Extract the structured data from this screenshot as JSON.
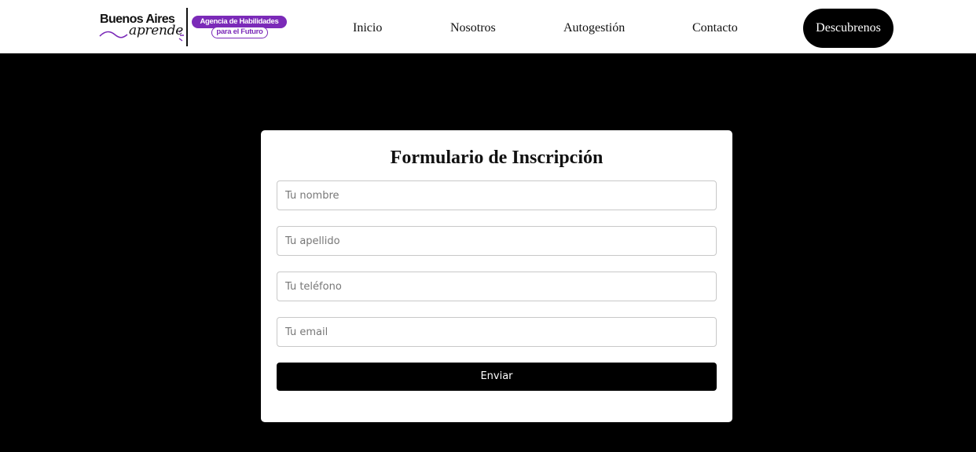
{
  "brand": {
    "name_line1": "Buenos Aires",
    "name_line2": "aprende",
    "badge_top": "Agencia de Habilidades",
    "badge_bottom": "para el Futuro",
    "accent_color": "#7b2ab8"
  },
  "nav": {
    "items": [
      {
        "label": "Inicio"
      },
      {
        "label": "Nosotros"
      },
      {
        "label": "Autogestión"
      },
      {
        "label": "Contacto"
      }
    ],
    "cta_label": "Descubrenos"
  },
  "form": {
    "title": "Formulario de Inscripción",
    "fields": [
      {
        "name": "nombre",
        "placeholder": "Tu nombre",
        "value": ""
      },
      {
        "name": "apellido",
        "placeholder": "Tu apellido",
        "value": ""
      },
      {
        "name": "telefono",
        "placeholder": "Tu teléfono",
        "value": ""
      },
      {
        "name": "email",
        "placeholder": "Tu email",
        "value": ""
      }
    ],
    "submit_label": "Enviar"
  },
  "colors": {
    "page_background": "#000000",
    "header_background": "#ffffff",
    "card_background": "#ffffff",
    "button_background": "#000000"
  }
}
